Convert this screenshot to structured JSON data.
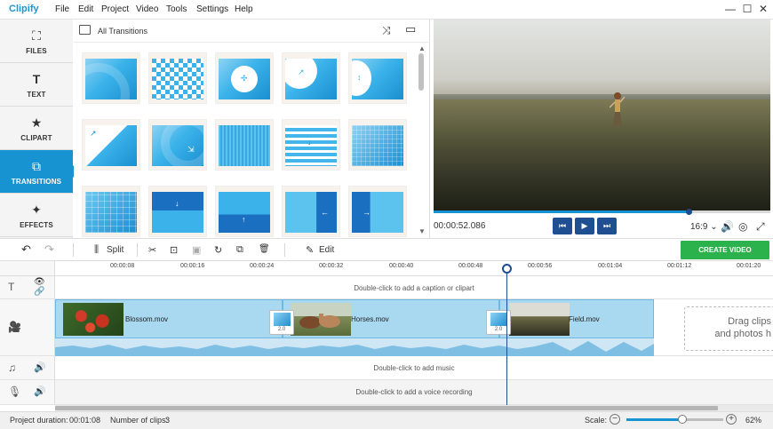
{
  "app": {
    "logo": "Clipify"
  },
  "menu": [
    "File",
    "Edit",
    "Project",
    "Video",
    "Tools",
    "Settings",
    "Help"
  ],
  "window_controls": {
    "minimize": "—",
    "maximize": "☐",
    "close": "✕"
  },
  "left_nav": [
    {
      "label": "FILES",
      "icon": "image-icon",
      "glyph": "⛶"
    },
    {
      "label": "TEXT",
      "icon": "text-icon",
      "glyph": "T"
    },
    {
      "label": "CLIPART",
      "icon": "star-icon",
      "glyph": "★"
    },
    {
      "label": "TRANSITIONS",
      "icon": "transitions-icon",
      "glyph": "⧉",
      "active": true
    },
    {
      "label": "EFFECTS",
      "icon": "magic-wand-icon",
      "glyph": "✦"
    }
  ],
  "transitions_panel": {
    "title": "All Transitions",
    "shuffle_glyph": "⤨",
    "view_glyph": "▭"
  },
  "player": {
    "timecode": "00:00:52.086",
    "progress": 0.757,
    "aspect": "16:9 ⌄",
    "buttons": {
      "prev": "⏮",
      "play": "▶",
      "next": "⏭"
    },
    "icons": {
      "volume": "🔊",
      "snapshot": "◎",
      "fullscreen": "⤢"
    }
  },
  "toolbar": {
    "undo": "↶",
    "redo": "↷",
    "split_label": "Split",
    "edit_label": "Edit",
    "create_label": "CREATE VIDEO",
    "tool_glyphs": {
      "cut": "✂",
      "crop": "⊡",
      "color": "▣",
      "rotate": "↻",
      "dup": "⧉",
      "delete": "🗑"
    }
  },
  "ruler": [
    "00:00:08",
    "00:00:16",
    "00:00:24",
    "00:00:32",
    "00:00:40",
    "00:00:48",
    "00:00:56",
    "00:01:04",
    "00:01:12",
    "00:01:20"
  ],
  "tracks": {
    "caption_hint": "Double-click to add a caption or clipart",
    "music_hint": "Double-click to add music",
    "voice_hint": "Double-click to add a voice recording",
    "drag_hint_1": "Drag clips",
    "drag_hint_2": "and photos h"
  },
  "clips": [
    {
      "name": "Blossom.mov"
    },
    {
      "name": "Horses.mov"
    },
    {
      "name": "Field.mov"
    }
  ],
  "transitions_in_timeline": [
    "2.0",
    "2.0"
  ],
  "status": {
    "duration_label": "Project duration:",
    "duration_value": "00:01:08",
    "clips_label": "Number of clips:",
    "clips_value": "3",
    "scale_label": "Scale:",
    "scale_value": "62%",
    "scale_fraction": 0.58
  },
  "colors": {
    "accent": "#1793d2",
    "create": "#2bb24c",
    "player_btn": "#1f4e91"
  }
}
